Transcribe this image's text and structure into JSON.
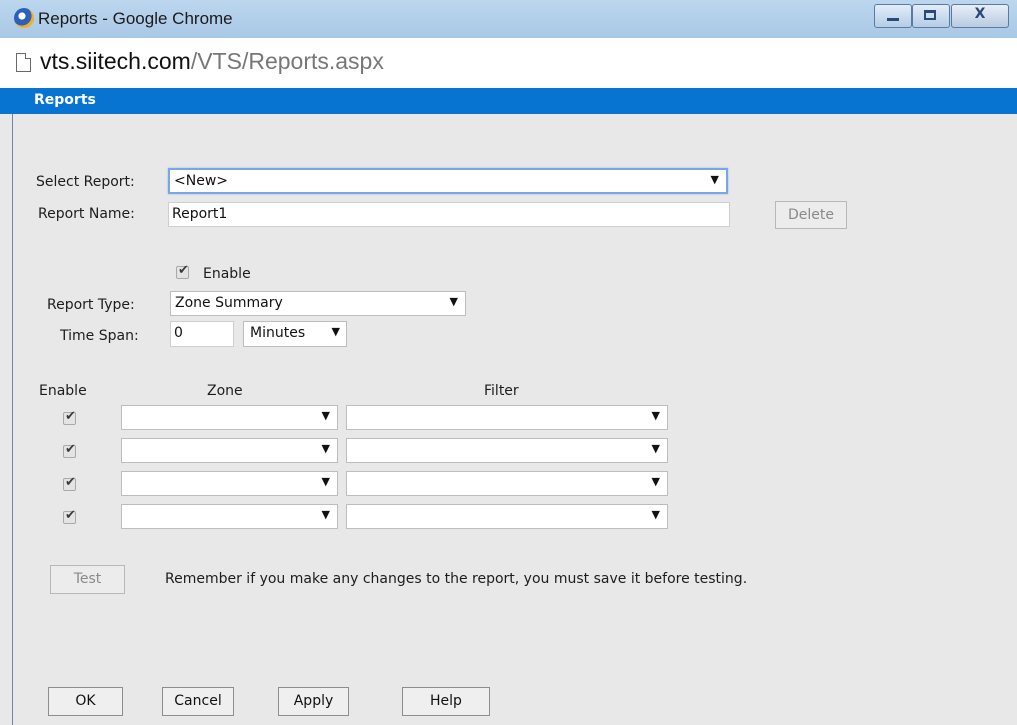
{
  "window": {
    "title": "Reports - Google Chrome",
    "minimize_glyph": "",
    "maximize_glyph": "",
    "close_glyph": "X"
  },
  "address": {
    "host": "vts.siitech.com",
    "path": "/VTS/Reports.aspx"
  },
  "header": {
    "title": "Reports"
  },
  "form": {
    "select_report_label": "Select Report:",
    "select_report_value": "<New>",
    "report_name_label": "Report Name:",
    "report_name_value": "Report1",
    "delete_label": "Delete",
    "enable_label": "Enable",
    "enable_checked": true,
    "report_type_label": "Report Type:",
    "report_type_value": "Zone Summary",
    "time_span_label": "Time Span:",
    "time_span_value": "0",
    "time_unit_value": "Minutes"
  },
  "table": {
    "columns": [
      "Enable",
      "Zone",
      "Filter"
    ],
    "rows": [
      {
        "enabled": true,
        "zone": "",
        "filter": ""
      },
      {
        "enabled": true,
        "zone": "",
        "filter": ""
      },
      {
        "enabled": true,
        "zone": "",
        "filter": ""
      },
      {
        "enabled": true,
        "zone": "",
        "filter": ""
      }
    ]
  },
  "test": {
    "label": "Test",
    "note": "Remember if you make any changes to the report, you must save it before testing."
  },
  "footer": {
    "ok": "OK",
    "cancel": "Cancel",
    "apply": "Apply",
    "help": "Help"
  },
  "icons": {
    "dropdown_arrow": "▼",
    "checkmark": "✔"
  }
}
